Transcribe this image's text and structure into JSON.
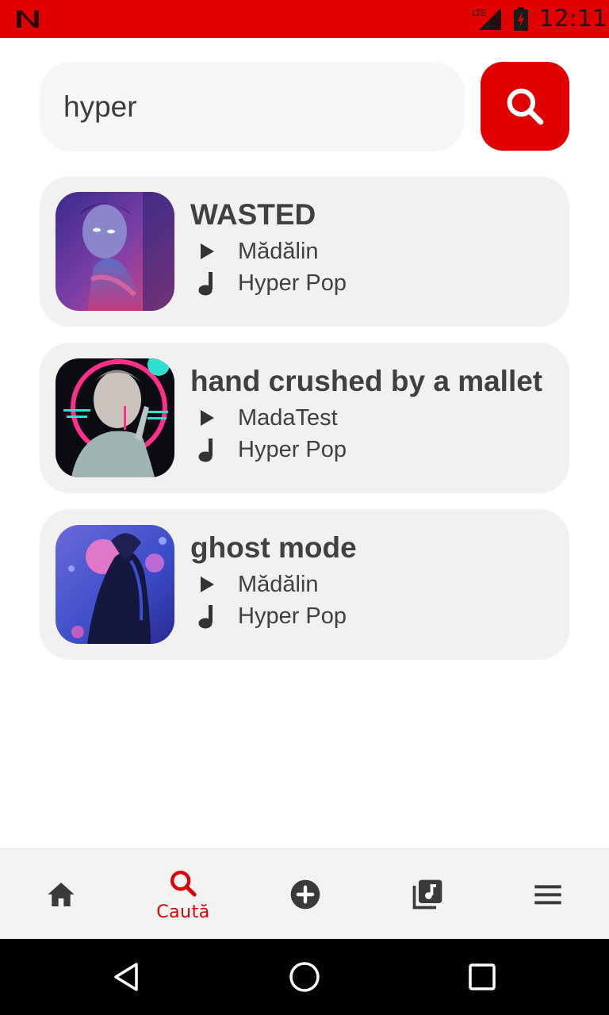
{
  "status_bar": {
    "time": "12:11",
    "network": "LTE",
    "accent": "#e00000"
  },
  "search": {
    "value": "hyper",
    "button_icon": "search-icon"
  },
  "results": [
    {
      "title": "WASTED",
      "artist": "Mădălin",
      "genre": "Hyper Pop",
      "cover": "statue-neon-cover"
    },
    {
      "title": "hand crushed by a mallet",
      "artist": "MadaTest",
      "genre": "Hyper Pop",
      "cover": "bust-ring-cover"
    },
    {
      "title": "ghost mode",
      "artist": "Mădălin",
      "genre": "Hyper Pop",
      "cover": "veiled-figure-cover"
    }
  ],
  "bottom_nav": {
    "active": "search",
    "items": [
      {
        "icon": "home-icon",
        "label": ""
      },
      {
        "icon": "search-icon",
        "label": "Caută"
      },
      {
        "icon": "add-circle-icon",
        "label": ""
      },
      {
        "icon": "library-music-icon",
        "label": ""
      },
      {
        "icon": "menu-icon",
        "label": ""
      }
    ]
  },
  "system_nav": {
    "items": [
      "back-icon",
      "home-circle-icon",
      "recents-icon"
    ]
  }
}
